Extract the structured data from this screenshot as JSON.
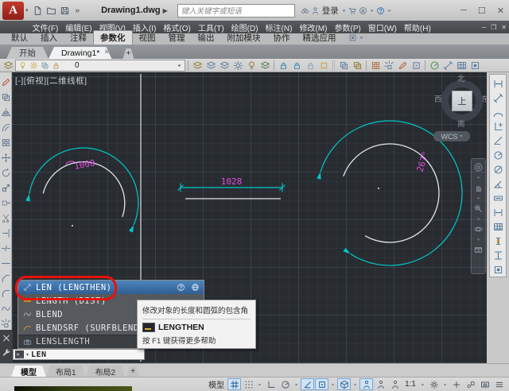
{
  "title_bar": {
    "logo_letter": "A",
    "quick_access": [
      {
        "name": "new-file-button",
        "icon": "newdoc"
      },
      {
        "name": "open-file-button",
        "icon": "folder"
      },
      {
        "name": "save-file-button",
        "icon": "floppy"
      }
    ],
    "more_tools_label": "»",
    "doc_title": "Drawing1.dwg",
    "search_placeholder": "键入关键字或短语",
    "sign_in_label": "登录",
    "window_buttons": {
      "minimize": "─",
      "maximize": "☐",
      "close": "✕"
    }
  },
  "menu_bar": {
    "items": [
      "文件(F)",
      "编辑(E)",
      "视图(V)",
      "插入(I)",
      "格式(O)",
      "工具(T)",
      "绘图(D)",
      "标注(N)",
      "修改(M)",
      "参数(P)",
      "窗口(W)",
      "帮助(H)"
    ],
    "window_controls": [
      "─",
      "❐",
      "✕"
    ]
  },
  "ribbon": {
    "tabs": [
      "默认",
      "插入",
      "注释",
      "参数化",
      "视图",
      "管理",
      "输出",
      "附加模块",
      "协作",
      "精选应用"
    ],
    "active_tab": "参数化"
  },
  "file_tabs": {
    "tabs": [
      {
        "label": "开始",
        "active": false
      },
      {
        "label": "Drawing1*",
        "active": true,
        "close": "✕"
      }
    ],
    "new_tab_label": "+"
  },
  "layer_toolbar": {
    "properties_button": {
      "name": "layer-properties-button",
      "icon": "layers2",
      "color": "#8f7a35"
    },
    "layer_panel": {
      "layer_name": "0",
      "icons": [
        {
          "name": "layer-on-icon",
          "icon": "bulb",
          "color": "#c9a23a"
        },
        {
          "name": "layer-thaw-icon",
          "icon": "sun",
          "color": "#c9a23a"
        },
        {
          "name": "layer-viewport-freeze-icon",
          "icon": "copy",
          "color": "#7c93aa"
        },
        {
          "name": "layer-unlock-icon",
          "icon": "locksm",
          "color": "#b09a4a"
        },
        {
          "name": "layer-color-swatch",
          "icon": "sqw",
          "color": "#f0f0f0"
        }
      ]
    },
    "groups": [
      {
        "name": "layer-tools-group",
        "thick": false,
        "items": [
          {
            "name": "layer-state-button",
            "icon": "layers2",
            "color": "#8f7a35"
          },
          {
            "name": "layer-isolate-button",
            "icon": "layers2",
            "color": "#5b7d9c"
          },
          {
            "name": "layer-unisolate-button",
            "icon": "layers2",
            "color": "#5b7d9c"
          },
          {
            "name": "layer-freeze-button",
            "icon": "sun",
            "color": "#5b7d9c"
          },
          {
            "name": "layer-off-button",
            "icon": "bulb",
            "color": "#8f7a35"
          },
          {
            "name": "layer-make-current-button",
            "icon": "layers2",
            "color": "#4a7a4a"
          }
        ]
      },
      {
        "name": "layer-lock-group",
        "thick": false,
        "items": [
          {
            "name": "layer-lock-button",
            "icon": "locksm",
            "color": "#3f88a8"
          },
          {
            "name": "layer-unlock-button",
            "icon": "locksm",
            "color": "#3f88a8"
          },
          {
            "name": "layer-lock-fade-button",
            "icon": "locksm",
            "color": "#8aa8c0"
          },
          {
            "name": "layer-walk-button",
            "icon": "sqw",
            "color": "#c9a23a"
          }
        ]
      },
      {
        "name": "clipboard-group",
        "thick": true,
        "items": [
          {
            "name": "match-properties-button",
            "icon": "copy",
            "color": "#5b7d9c"
          },
          {
            "name": "copy-nested-objects-button",
            "icon": "copy",
            "color": "#8f7a35"
          }
        ]
      },
      {
        "name": "group-tools-group",
        "thick": false,
        "items": [
          {
            "name": "make-group-button",
            "icon": "array",
            "color": "#b06a3a"
          },
          {
            "name": "ungroup-button",
            "icon": "explode",
            "color": "#5b7d9c"
          },
          {
            "name": "group-edit-button",
            "icon": "pencil",
            "color": "#b05a3a"
          },
          {
            "name": "group-selection-toggle",
            "icon": "osnapsq",
            "color": "#5b7d9c"
          }
        ]
      },
      {
        "name": "utility-group",
        "thick": false,
        "items": [
          {
            "name": "measure-button",
            "icon": "raddim",
            "color": "#4a8a4a"
          },
          {
            "name": "quick-select-button",
            "icon": "adim",
            "color": "#5b7d9c"
          },
          {
            "name": "quick-calc-button",
            "icon": "tablegrid",
            "color": "#5b7d9c"
          },
          {
            "name": "block-editor-button",
            "icon": "convert",
            "color": "#5b7d9c"
          }
        ]
      }
    ],
    "dropdown_icon": "chevd"
  },
  "viewport": {
    "label": "[-][俯视][二维线框]",
    "view_cube": {
      "north": "北",
      "south": "南",
      "east": "东",
      "west": "西",
      "top": "上"
    },
    "ucs_label": "WCS"
  },
  "drawing": {
    "dim_arc_length": "1000",
    "dim_linear": "1028",
    "dim_angle": "267°",
    "geometry_color": "#e3e6e9",
    "dimension_color": "#00c8c8",
    "dim_text_color": "#e14be1"
  },
  "modify_toolbar": [
    {
      "name": "erase-tool",
      "icon": "pencil",
      "color": "#b35742"
    },
    {
      "name": "copy-tool",
      "icon": "copy",
      "color": "#5f7590"
    },
    {
      "name": "mirror-tool",
      "icon": "mirror",
      "color": "#5f7590"
    },
    {
      "name": "offset-tool",
      "icon": "offset",
      "color": "#5f7590"
    },
    {
      "name": "array-tool",
      "icon": "array",
      "color": "#5f7590"
    },
    {
      "name": "move-tool",
      "icon": "move",
      "color": "#5f7590"
    },
    {
      "name": "rotate-tool",
      "icon": "rotate",
      "color": "#5f7590"
    },
    {
      "name": "scale-tool",
      "icon": "scale",
      "color": "#5f7590"
    },
    {
      "name": "stretch-tool",
      "icon": "stretch",
      "color": "#5f7590"
    },
    {
      "name": "trim-tool",
      "icon": "trim",
      "color": "#82878e"
    },
    {
      "name": "extend-tool",
      "icon": "extend",
      "color": "#5f7590"
    },
    {
      "name": "break-tool",
      "icon": "break",
      "color": "#5f7590"
    },
    {
      "name": "join-tool",
      "icon": "join",
      "color": "#5f7590"
    },
    {
      "name": "chamfer-tool",
      "icon": "chamfer",
      "color": "#5f7590"
    },
    {
      "name": "fillet-tool",
      "icon": "fillet",
      "color": "#5f7590"
    },
    {
      "name": "blend-curves-tool",
      "icon": "wavec",
      "color": "#5f7590"
    },
    {
      "name": "explode-tool",
      "icon": "explode",
      "color": "#5f7590"
    }
  ],
  "constraint_toolbar": [
    {
      "name": "linear-constraint",
      "icon": "hdim"
    },
    {
      "name": "aligned-constraint",
      "icon": "adim"
    },
    {
      "name": "arc-length-dimension",
      "icon": "arcdim"
    },
    {
      "name": "ordinate-dimension",
      "icon": "orddim"
    },
    {
      "name": "angular-lines-dimension",
      "icon": "angdim2"
    },
    {
      "name": "radius-constraint",
      "icon": "raddim"
    },
    {
      "name": "diameter-constraint",
      "icon": "diadim"
    },
    {
      "name": "angular-constraint",
      "icon": "angdim"
    },
    {
      "name": "dimensional-constraint",
      "icon": "dimbox"
    },
    {
      "name": "horizontal-constraint",
      "icon": "hdim"
    },
    {
      "name": "parameters-manager",
      "icon": "tablegrid"
    },
    {
      "name": "constraint-bar",
      "icon": "ibeam"
    },
    {
      "name": "vertical-constraint",
      "icon": "vdim"
    },
    {
      "name": "convert-constraint",
      "icon": "convert"
    }
  ],
  "nav_bar": [
    {
      "name": "navigation-wheel-button",
      "icon": "wheelnav"
    },
    {
      "name": "pan-button",
      "icon": "hand"
    },
    {
      "name": "zoom-button",
      "icon": "zoomx"
    },
    {
      "name": "orbit-button",
      "icon": "orbit"
    },
    {
      "name": "showmotion-button",
      "icon": "film"
    }
  ],
  "command_popup": {
    "rows": [
      {
        "label": "LEN (LENGTHEN)",
        "icon": "adim",
        "icon_color": "#a8c8e8",
        "state": "selected"
      },
      {
        "label": "LENGTH (DIST)",
        "icon": "ruler",
        "icon_color": "#d9a53a",
        "state": ""
      },
      {
        "label": "BLEND",
        "icon": "wavec",
        "icon_color": "#b8c0c8",
        "state": ""
      },
      {
        "label": "BLENDSRF (SURFBLEND)",
        "icon": "swoosh",
        "icon_color": "#e09a3c",
        "state": ""
      },
      {
        "label": "LENSLENGTH",
        "icon": "camlens",
        "icon_color": "#8899aa",
        "state": "dark"
      }
    ]
  },
  "tooltip": {
    "description": "修改对象的长度和圆弧的包含角",
    "command_name": "LENGTHEN",
    "help_text": "按 F1 键获得更多帮助"
  },
  "command_line": {
    "prompt": ">_",
    "dropdown": "▾",
    "value": "LEN"
  },
  "layout_tabs": {
    "tabs": [
      {
        "label": "模型",
        "active": true
      },
      {
        "label": "布局1",
        "active": false
      },
      {
        "label": "布局2",
        "active": false
      }
    ],
    "new_layout_label": "+"
  },
  "status_bar": {
    "items": [
      {
        "t": "text",
        "label": "模型",
        "name": "model-space-label"
      },
      {
        "t": "icon",
        "icon": "gridhash",
        "hl": true,
        "name": "grid-display-toggle"
      },
      {
        "t": "icon",
        "icon": "dots9",
        "hl": false,
        "name": "snap-mode-toggle"
      },
      {
        "t": "chev",
        "name": "snap-settings-dropdown"
      },
      {
        "t": "icon",
        "icon": "orthoL",
        "hl": false,
        "name": "ortho-mode-toggle"
      },
      {
        "t": "icon",
        "icon": "polar",
        "hl": false,
        "name": "polar-tracking-toggle"
      },
      {
        "t": "chev",
        "name": "polar-settings-dropdown"
      },
      {
        "t": "icon",
        "icon": "angleic",
        "hl": true,
        "name": "isometric-drafting-toggle"
      },
      {
        "t": "icon",
        "icon": "osnapsq",
        "hl": true,
        "name": "object-snap-toggle"
      },
      {
        "t": "chev",
        "name": "osnap-settings-dropdown"
      },
      {
        "t": "icon",
        "icon": "iso3d",
        "hl": true,
        "name": "object-snap-3d-toggle"
      },
      {
        "t": "chev",
        "name": "osnap3d-settings-dropdown"
      },
      {
        "t": "icon",
        "icon": "person",
        "hl": true,
        "name": "annotation-visibility-toggle"
      },
      {
        "t": "icon",
        "icon": "person",
        "hl": false,
        "name": "autoscale-annotations-toggle"
      },
      {
        "t": "icon",
        "icon": "person",
        "hl": false,
        "name": "annotation-scale-icon"
      },
      {
        "t": "text",
        "label": "1:1",
        "name": "annotation-scale-value"
      },
      {
        "t": "chev",
        "name": "annotation-scale-dropdown"
      },
      {
        "t": "icon",
        "icon": "gear",
        "hl": false,
        "name": "workspace-switching-button"
      },
      {
        "t": "chev",
        "name": "workspace-dropdown"
      },
      {
        "t": "icon",
        "icon": "plusic",
        "hl": false,
        "name": "customization-plus-button"
      },
      {
        "t": "icon",
        "icon": "isolate",
        "hl": false,
        "name": "isolate-objects-button"
      },
      {
        "t": "icon",
        "icon": "screenic",
        "hl": false,
        "name": "clean-screen-button"
      },
      {
        "t": "icon",
        "icon": "burger",
        "hl": false,
        "name": "status-customization-menu"
      }
    ]
  },
  "colors": {
    "selection_blue": "#3a6ea5",
    "annotation_red": "#e8120c",
    "cyan": "#00c8c8",
    "magenta": "#e14be1"
  }
}
